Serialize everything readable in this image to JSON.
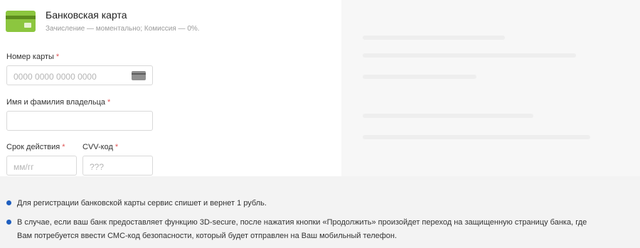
{
  "method": {
    "title": "Банковская карта",
    "subtitle": "Зачисление — моментально; Комиссия — 0%.",
    "icon": "bank-card-icon",
    "accent": "#8cc63f"
  },
  "form": {
    "card_number": {
      "label": "Номер карты",
      "required_mark": "*",
      "placeholder": "0000 0000 0000 0000",
      "icon": "credit-card-icon"
    },
    "holder_name": {
      "label": "Имя и фамилия владельца",
      "required_mark": "*",
      "placeholder": ""
    },
    "expiry": {
      "label": "Срок действия",
      "required_mark": "*",
      "placeholder": "мм/гг"
    },
    "cvv": {
      "label": "CVV-код",
      "required_mark": "*",
      "placeholder": "???"
    }
  },
  "notes": [
    "Для регистрации банковской карты сервис спишет и вернет 1 рубль.",
    "В случае, если ваш банк предоставляет функцию 3D-secure, после нажатия кнопки «Продолжить» произойдет переход на защищенную страницу банка, где",
    "Вам потребуется ввести СМС-код безопасности, который будет отправлен на Ваш мобильный телефон."
  ],
  "colors": {
    "bullet": "#1f5fbf",
    "required": "#e05555"
  }
}
